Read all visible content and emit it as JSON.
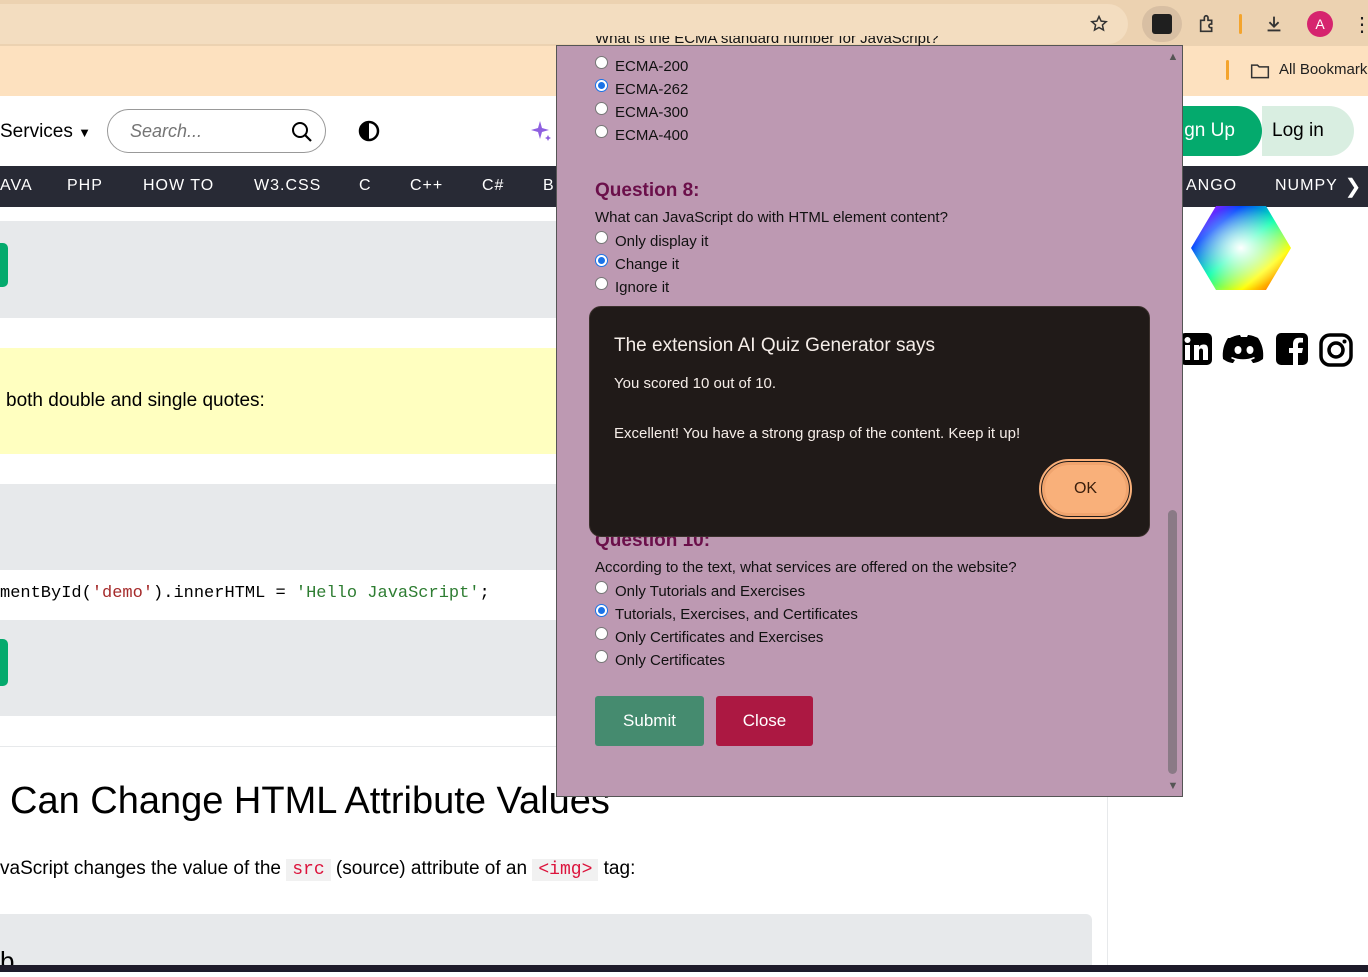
{
  "browser": {
    "bookmarks_label": "All Bookmark",
    "profile_initial": "A"
  },
  "site": {
    "services_label": "Services",
    "search_placeholder": "Search...",
    "signup_label": "ign Up",
    "login_label": "Log in",
    "nav": [
      "AVA",
      "PHP",
      "HOW TO",
      "W3.CSS",
      "C",
      "C++",
      "C#",
      "B",
      "ANGO",
      "NUMPY"
    ],
    "quote_text": "both double and single quotes:",
    "code": {
      "prefix": "mentById(",
      "arg": "'demo'",
      "middle": ").innerHTML = ",
      "value": "'Hello JavaScript'",
      "suffix": ";"
    },
    "heading": "Can Change HTML Attribute Values",
    "para": {
      "p1": "vaScript changes the value of the ",
      "code1": "src",
      "p2": " (source) attribute of an ",
      "code2": "<img>",
      "p3": " tag:"
    },
    "bottom_letter": "b"
  },
  "quiz": {
    "q7_text_partial": "What is the ECMA standard number for JavaScript?",
    "q7_options": [
      "ECMA-200",
      "ECMA-262",
      "ECMA-300",
      "ECMA-400"
    ],
    "q7_selected": 1,
    "q8_title": "Question 8:",
    "q8_text": "What can JavaScript do with HTML element content?",
    "q8_options": [
      "Only display it",
      "Change it",
      "Ignore it"
    ],
    "q8_selected": 1,
    "q10_title": "Question 10:",
    "q10_text": "According to the text, what services are offered on the website?",
    "q10_options": [
      "Only Tutorials and Exercises",
      "Tutorials, Exercises, and Certificates",
      "Only Certificates and Exercises",
      "Only Certificates"
    ],
    "q10_selected": 1,
    "submit_label": "Submit",
    "close_label": "Close"
  },
  "alert": {
    "title": "The extension AI Quiz Generator says",
    "line1": "You scored 10 out of 10.",
    "line2": "Excellent! You have a strong grasp of the content. Keep it up!",
    "ok_label": "OK"
  },
  "colors": {
    "accent_green": "#04aa6d",
    "quiz_bg": "#bd99b2",
    "question_title": "#6b0f4a",
    "submit": "#458b6f",
    "close": "#ac1842",
    "alert_bg": "#201a18",
    "ok_button": "#f9b07a"
  }
}
